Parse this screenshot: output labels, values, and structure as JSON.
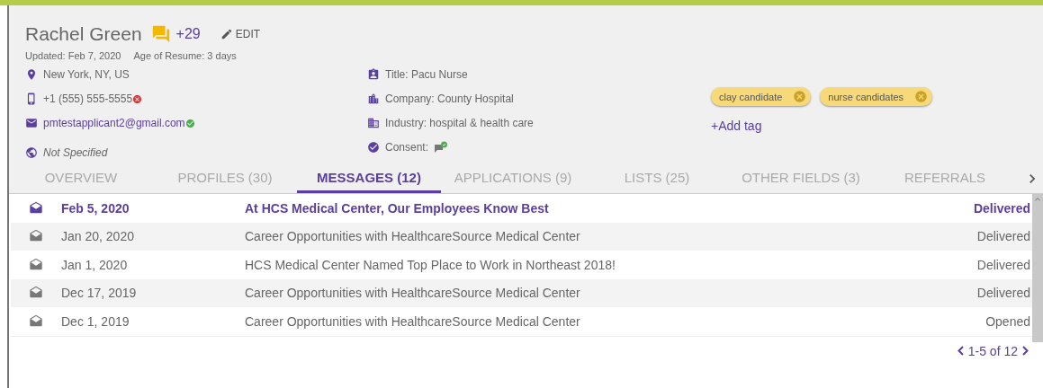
{
  "candidate": {
    "name": "Rachel Green",
    "notes_count": "+29",
    "edit_label": "EDIT",
    "updated": "Updated: Feb 7, 2020",
    "resume_age": "Age of Resume: 3 days"
  },
  "contact": [
    {
      "kind": "location",
      "text": "New York, NY, US"
    },
    {
      "kind": "phone",
      "text": "+1 (555) 555-5555",
      "verified": false
    },
    {
      "kind": "email",
      "text": "pmtestapplicant2@gmail.com",
      "verified": true
    },
    {
      "kind": "website",
      "text": "Not Specified"
    }
  ],
  "details": [
    {
      "kind": "title",
      "text": "Title: Pacu Nurse"
    },
    {
      "kind": "company",
      "text": "Company: County Hospital"
    },
    {
      "kind": "industry",
      "text": "Industry: hospital & health care"
    },
    {
      "kind": "consent",
      "text": "Consent:"
    }
  ],
  "tags": [
    {
      "label": "clay candidate"
    },
    {
      "label": "nurse candidates"
    }
  ],
  "add_tag": "+Add tag",
  "tabs": [
    {
      "label": "OVERVIEW",
      "selected": false
    },
    {
      "label": "PROFILES (30)",
      "selected": false
    },
    {
      "label": "MESSAGES (12)",
      "selected": true
    },
    {
      "label": "APPLICATIONS (9)",
      "selected": false
    },
    {
      "label": "LISTS (25)",
      "selected": false
    },
    {
      "label": "OTHER FIELDS (3)",
      "selected": false
    },
    {
      "label": "REFERRALS",
      "selected": false
    }
  ],
  "messages": [
    {
      "date": "Feb 5, 2020",
      "subject": "At HCS Medical Center, Our Employees Know Best",
      "status": "Delivered",
      "unread": true
    },
    {
      "date": "Jan 20, 2020",
      "subject": "Career Opportunities with HealthcareSource Medical Center",
      "status": "Delivered",
      "unread": false
    },
    {
      "date": "Jan 1, 2020",
      "subject": "HCS Medical Center Named Top Place to Work in Northeast 2018!",
      "status": "Delivered",
      "unread": false
    },
    {
      "date": "Dec 17, 2019",
      "subject": "Career Opportunities with HealthcareSource Medical Center",
      "status": "Delivered",
      "unread": false
    },
    {
      "date": "Dec 1, 2019",
      "subject": "Career Opportunities with HealthcareSource Medical Center",
      "status": "Opened",
      "unread": false
    }
  ],
  "pagination": "1-5 of 12"
}
